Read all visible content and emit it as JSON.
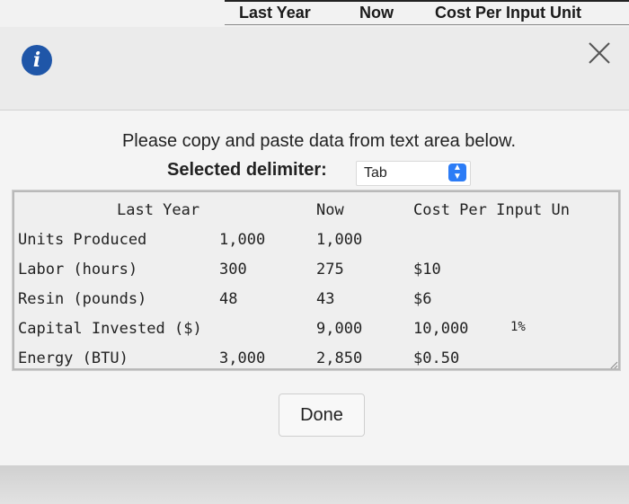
{
  "background_table": {
    "headers": [
      "Last Year",
      "Now",
      "Cost Per Input Unit"
    ]
  },
  "dialog": {
    "info_icon": "info-icon",
    "close_icon": "close-icon",
    "instruction": "Please copy and paste data from text area below.",
    "delimiter_label": "Selected delimiter:",
    "delimiter_value": "Tab",
    "textarea": {
      "header": [
        "Last Year",
        "Now",
        "Cost Per Input Un"
      ],
      "rows": [
        {
          "label": "Units Produced",
          "last_year": "1,000",
          "now": "1,000",
          "cost": "",
          "extra": ""
        },
        {
          "label": "Labor (hours)",
          "last_year": "300",
          "now": "275",
          "cost": "$10",
          "extra": ""
        },
        {
          "label": "Resin (pounds)",
          "last_year": "48",
          "now": "43",
          "cost": "$6",
          "extra": ""
        },
        {
          "label": "Capital Invested ($)",
          "last_year": "",
          "now": "9,000",
          "cost": "10,000",
          "extra": "1%"
        },
        {
          "label": "Energy (BTU)",
          "last_year": "3,000",
          "now": "2,850",
          "cost": "$0.50",
          "extra": ""
        }
      ]
    },
    "done_label": "Done"
  }
}
